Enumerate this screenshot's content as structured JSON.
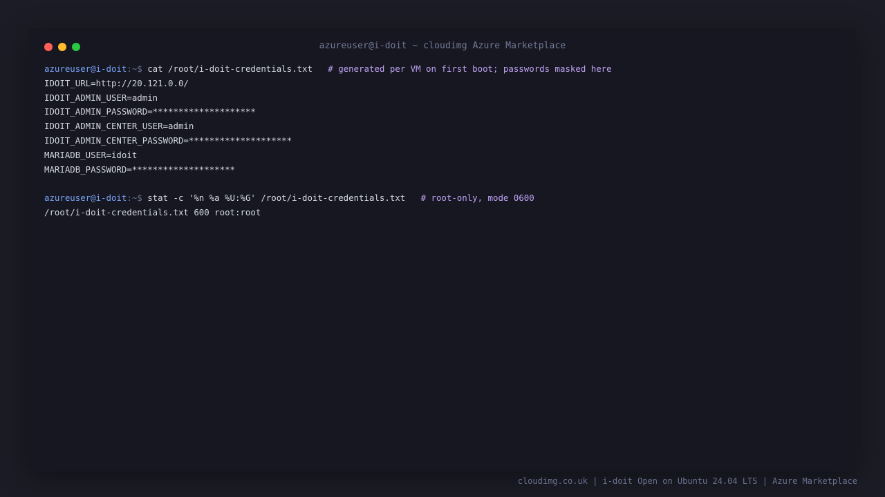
{
  "window": {
    "title": "azureuser@i-doit ~ cloudimg Azure Marketplace"
  },
  "terminal": {
    "block1": {
      "user": "azureuser@i-doit",
      "path": ":~$ ",
      "command": "cat /root/i-doit-credentials.txt   ",
      "comment": "# generated per VM on first boot; passwords masked here",
      "output": [
        "IDOIT_URL=http://20.121.0.0/",
        "IDOIT_ADMIN_USER=admin",
        "IDOIT_ADMIN_PASSWORD=********************",
        "IDOIT_ADMIN_CENTER_USER=admin",
        "IDOIT_ADMIN_CENTER_PASSWORD=********************",
        "MARIADB_USER=idoit",
        "MARIADB_PASSWORD=********************"
      ]
    },
    "block2": {
      "user": "azureuser@i-doit",
      "path": ":~$ ",
      "command": "stat -c '%n %a %U:%G' /root/i-doit-credentials.txt   ",
      "comment": "# root-only, mode 0600",
      "output": [
        "/root/i-doit-credentials.txt 600 root:root"
      ]
    }
  },
  "footer": {
    "text": "cloudimg.co.uk | i-doit Open on Ubuntu 24.04 LTS | Azure Marketplace"
  }
}
